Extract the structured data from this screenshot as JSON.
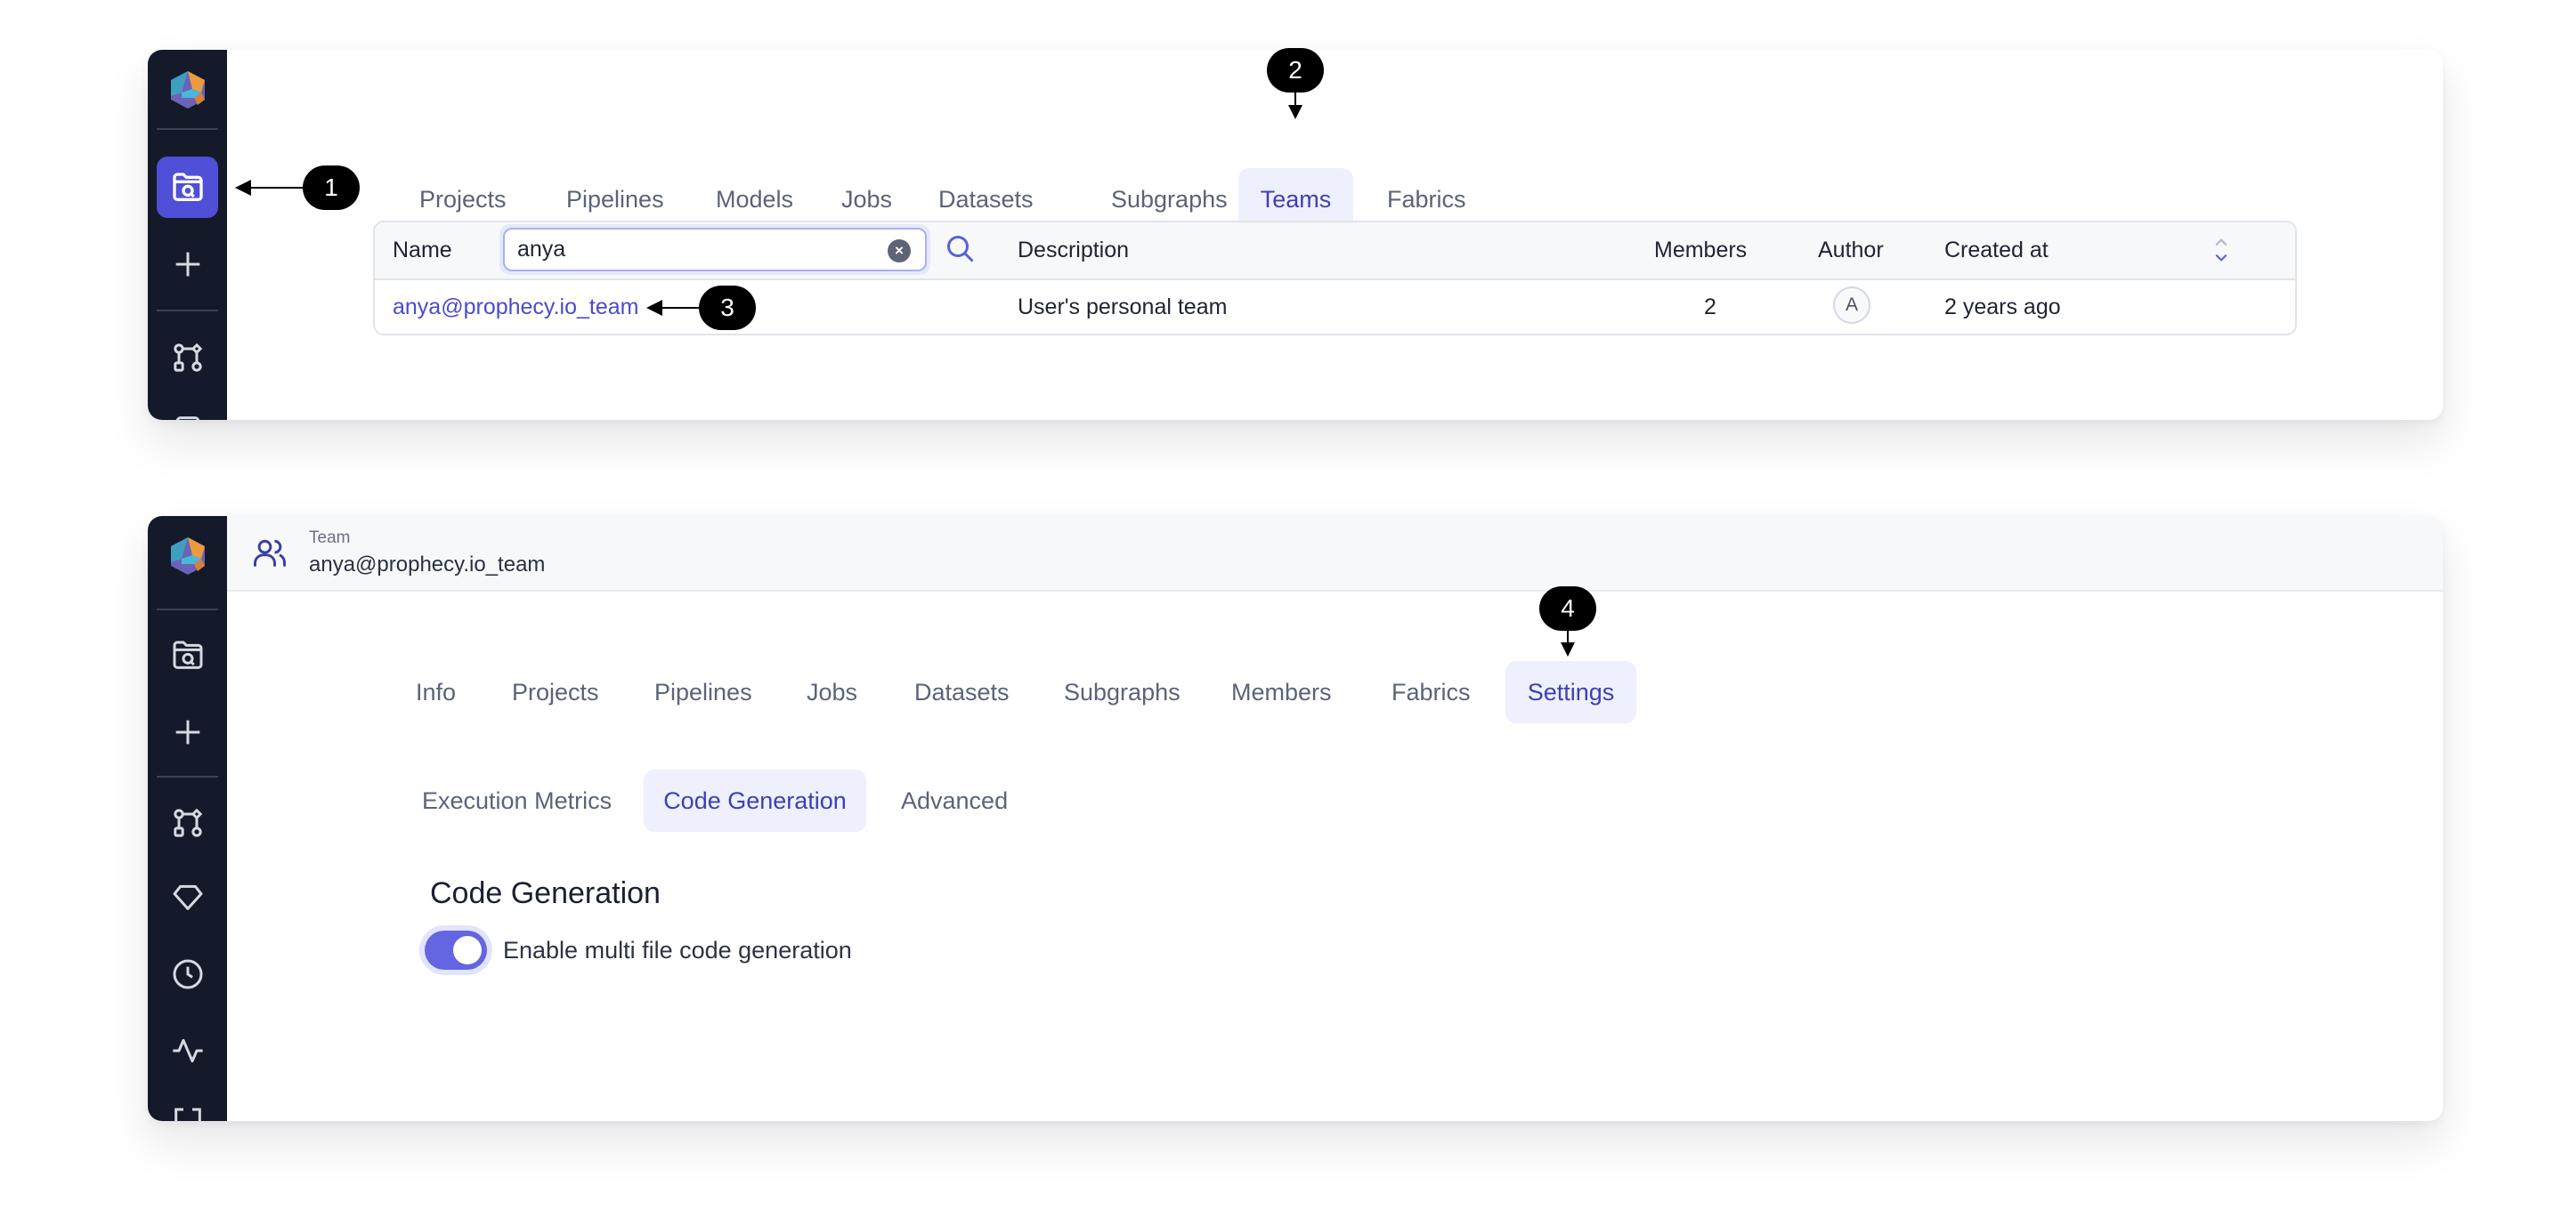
{
  "panel1": {
    "nav_tabs": [
      {
        "label": "Projects",
        "active": false
      },
      {
        "label": "Pipelines",
        "active": false
      },
      {
        "label": "Models",
        "active": false
      },
      {
        "label": "Jobs",
        "active": false
      },
      {
        "label": "Datasets",
        "active": false
      },
      {
        "label": "Subgraphs",
        "active": false
      },
      {
        "label": "Teams",
        "active": true
      },
      {
        "label": "Fabrics",
        "active": false
      }
    ],
    "table": {
      "columns": [
        "Name",
        "Description",
        "Members",
        "Author",
        "Created at"
      ],
      "search": {
        "value": "anya",
        "placeholder": ""
      },
      "rows": [
        {
          "name": "anya@prophecy.io_team",
          "description": "User's personal team",
          "members": "2",
          "author_initial": "A",
          "created_at": "2 years ago"
        }
      ]
    }
  },
  "panel2": {
    "header": {
      "label": "Team",
      "value": "anya@prophecy.io_team"
    },
    "nav_tabs": [
      {
        "label": "Info",
        "active": false
      },
      {
        "label": "Projects",
        "active": false
      },
      {
        "label": "Pipelines",
        "active": false
      },
      {
        "label": "Jobs",
        "active": false
      },
      {
        "label": "Datasets",
        "active": false
      },
      {
        "label": "Subgraphs",
        "active": false
      },
      {
        "label": "Members",
        "active": false
      },
      {
        "label": "Fabrics",
        "active": false
      },
      {
        "label": "Settings",
        "active": true
      }
    ],
    "sub_tabs": [
      {
        "label": "Execution Metrics",
        "active": false
      },
      {
        "label": "Code Generation",
        "active": true
      },
      {
        "label": "Advanced",
        "active": false
      }
    ],
    "section_title": "Code Generation",
    "toggle": {
      "label": "Enable multi file code generation",
      "enabled": true
    }
  },
  "sidebar_icons_panel1": [
    "logo",
    "search-folder-icon",
    "plus-icon",
    "pipeline-graph-icon"
  ],
  "sidebar_icons_panel2": [
    "logo",
    "search-folder-icon",
    "plus-icon",
    "pipeline-graph-icon",
    "gem-icon",
    "clock-icon",
    "activity-icon"
  ],
  "callouts": [
    "1",
    "2",
    "3",
    "4"
  ],
  "colors": {
    "accent": "#4f4fd8",
    "active_tab_bg": "#eef0fd",
    "active_tab_text": "#3d3fb5",
    "sidebar_bg": "#141a29",
    "link": "#4a4ad0"
  }
}
